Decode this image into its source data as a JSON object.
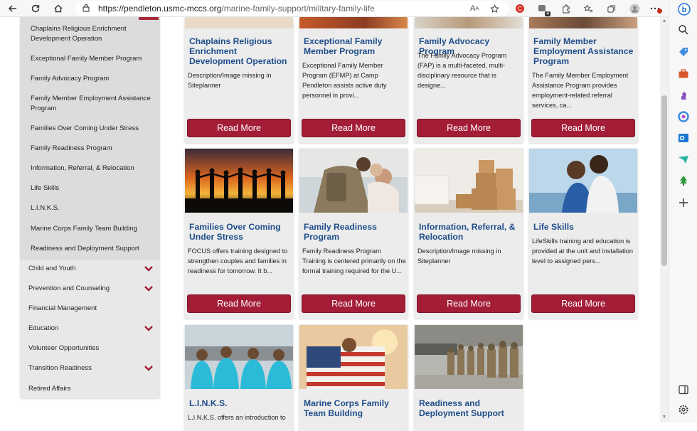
{
  "browser": {
    "url_host": "https://pendleton.usmc-mccs.org",
    "url_path": "/marine-family-support/military-family-life",
    "ext_badge": "4"
  },
  "submenu": [
    "Chaplains Religious Enrichment Development Operation",
    "Exceptional Family Member Program",
    "Family Advocacy Program",
    "Family Member Employment Assistance Program",
    "Families Over Coming Under Stress",
    "Family Readiness Program",
    "Information, Referral, & Relocation",
    "Life Skills",
    "L.I.N.K.S.",
    "Marine Corps Family Team Building",
    "Readiness and Deployment Support"
  ],
  "menu": [
    {
      "label": "Child and Youth",
      "expandable": true
    },
    {
      "label": "Prevention and Counseling",
      "expandable": true
    },
    {
      "label": "Financial Management",
      "expandable": false
    },
    {
      "label": "Education",
      "expandable": true
    },
    {
      "label": "Volunteer Opportunities",
      "expandable": false
    },
    {
      "label": "Transition Readiness",
      "expandable": true
    },
    {
      "label": "Retired Affairs",
      "expandable": false
    }
  ],
  "read_more_label": "Read More",
  "cards": [
    {
      "title": "Chaplains Religious Enrichment Development Operation",
      "desc": "Description/Image missing in Siteplanner"
    },
    {
      "title": "Exceptional Family Member Program",
      "desc": "Exceptional Family Member Program (EFMP) at Camp Pendleton assists active duty personnel in provi..."
    },
    {
      "title": "Family Advocacy Program",
      "desc": "The Family Advocacy Program (FAP) is a multi-faceted, multi-disciplinary resource that is designe..."
    },
    {
      "title": "Family Member Employment Assistance Program",
      "desc": "The Family Member Employment Assistance Program provides employment-related referral services, ca..."
    },
    {
      "title": "Families Over Coming Under Stress",
      "desc": "FOCUS offers training designed to strengthen couples and families in readiness for tomorrow. It b..."
    },
    {
      "title": "Family Readiness Program",
      "desc": "Family Readiness Program Training is centered primarily on the formal training required for the U..."
    },
    {
      "title": "Information, Referral, & Relocation",
      "desc": "Description/Image missing in Siteplanner"
    },
    {
      "title": "Life Skills",
      "desc": "LifeSkills training and education is provided at the unit and installation level to assigned pers..."
    },
    {
      "title": "L.I.N.K.S.",
      "desc": "L.I.N.K.S. offers an introduction to"
    },
    {
      "title": "Marine Corps Family Team Building",
      "desc": ""
    },
    {
      "title": "Readiness and Deployment Support",
      "desc": ""
    }
  ],
  "colors": {
    "button": "#a31d36",
    "title": "#1f4e8b",
    "chevron": "#a31d36"
  },
  "icons": [
    "back-arrow-icon",
    "refresh-icon",
    "home-icon",
    "lock-icon",
    "read-aloud-icon",
    "favorite-star-icon",
    "profile-avatar-icon",
    "settings-gear-icon"
  ]
}
